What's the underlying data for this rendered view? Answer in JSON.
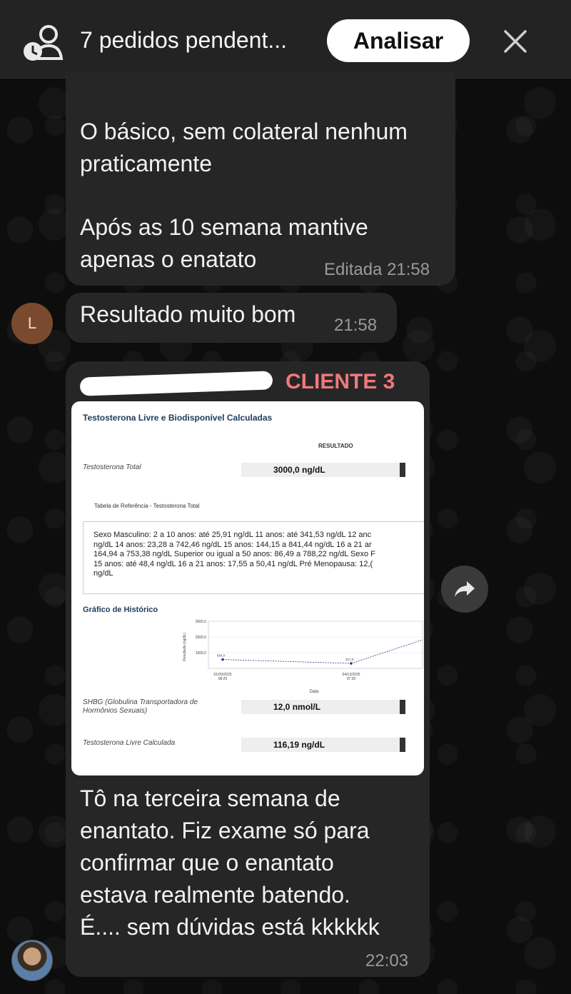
{
  "banner": {
    "requests_text": "7 pedidos pendent...",
    "review_button": "Analisar"
  },
  "messages": {
    "m1": {
      "lines_a": [
        "O básico, sem colateral nenhum",
        "praticamente"
      ],
      "lines_b": [
        "Após as 10 semana mantive",
        "apenas o enatato"
      ],
      "time": "Editada 21:58"
    },
    "m2": {
      "text": "Resultado muito bom",
      "time": "21:58",
      "avatar_letter": "L"
    },
    "m3": {
      "sender_tag": "CLIENTE 3",
      "text_lines": [
        "Tô na terceira semana de",
        "enantato. Fiz exame só para",
        "confirmar que o enantato",
        "estava realmente batendo.",
        "É.... sem dúvidas está kkkkkk"
      ],
      "time": "22:03"
    }
  },
  "report": {
    "title": "Testosterona Livre e Biodisponível Calculadas",
    "result_header": "RESULTADO",
    "rows": [
      {
        "label": "Testosterona Total",
        "value": "3000,0 ng/dL"
      },
      {
        "label": "SHBG (Globulina Transportadora de Hormônios Sexuais)",
        "value": "12,0 nmol/L"
      },
      {
        "label": "Testosterona Livre Calculada",
        "value": "116,19 ng/dL"
      }
    ],
    "reference_title": "Tabela de Referência - Testosterona Total",
    "reference_lines": [
      "Sexo Masculino: 2 a 10 anos: até 25,91 ng/dL 11 anos: até 341,53 ng/dL 12 anc",
      "ng/dL 14 anos: 23,28 a 742,46 ng/dL 15 anos: 144,15 a 841,44 ng/dL 16 a 21 ar",
      "164,94 a 753,38 ng/dL Superior ou igual a 50 anos: 86,49 a 788,22 ng/dL Sexo F",
      "15 anos: até 48,4 ng/dL 16 a 21 anos: 17,55 a 50,41 ng/dL Pré Menopausa: 12,(",
      "ng/dL"
    ],
    "history_title": "Gráfico de Histórico"
  },
  "chart_data": {
    "type": "line",
    "title": "Gráfico de Histórico",
    "ylabel": "Resultado (ng/dL)",
    "xlabel": "Data",
    "yticks": [
      "3000,0",
      "2000,0",
      "1000,0"
    ],
    "ylim": [
      0,
      3000
    ],
    "x": [
      "01/09/2025 08:25",
      "04/12/2025 07:30"
    ],
    "series": [
      {
        "values": [
          564.0,
          317.0
        ],
        "point_labels": [
          "564,0",
          "317,0"
        ]
      }
    ],
    "grid": true
  },
  "colors": {
    "bubble": "#262626",
    "banner": "#232323",
    "sender_tag": "#f0787c",
    "report_heading": "#1d3c5a"
  }
}
